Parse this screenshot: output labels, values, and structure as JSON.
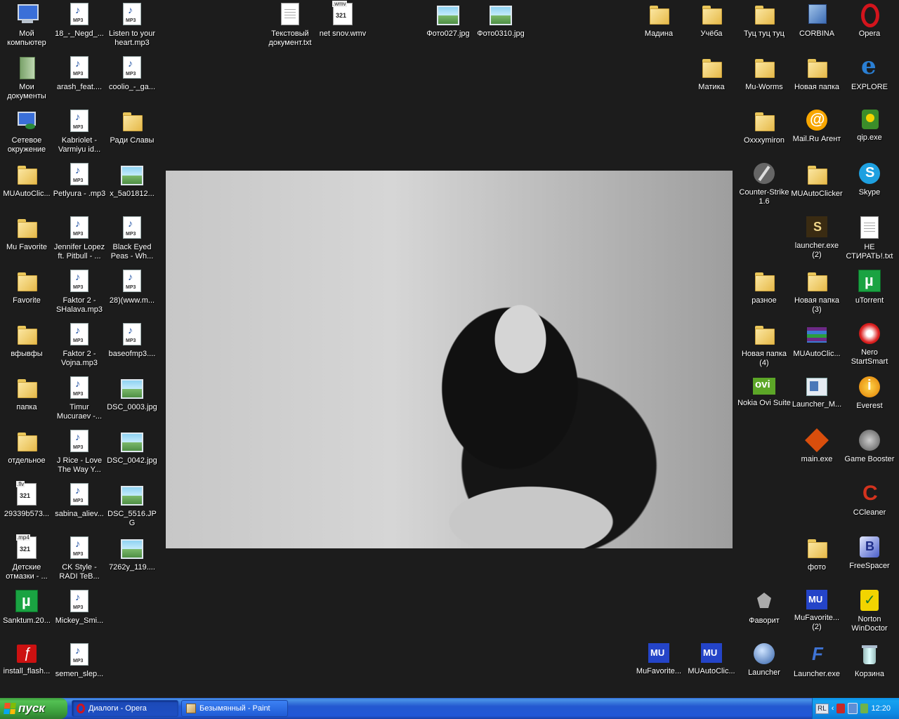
{
  "desktop": {
    "icons": [
      {
        "label": "Мой компьютер",
        "glyph": "g-computer",
        "icon": "computer-icon"
      },
      {
        "label": "18_-_Negd_...",
        "glyph": "g-mp3",
        "icon": "mp3-file-icon"
      },
      {
        "label": "Listen to your heart.mp3",
        "glyph": "g-mp3",
        "icon": "mp3-file-icon"
      },
      {
        "label": "Текстовый документ.txt",
        "glyph": "g-txt",
        "icon": "text-file-icon"
      },
      {
        "label": "net snov.wmv",
        "glyph": "g-video",
        "icon": "video-file-icon",
        "ext": ".wmv"
      },
      {
        "label": "Фото027.jpg",
        "glyph": "g-image",
        "icon": "image-file-icon"
      },
      {
        "label": "Фото0310.jpg",
        "glyph": "g-image",
        "icon": "image-file-icon"
      },
      {
        "label": "Мадина",
        "glyph": "g-folder",
        "icon": "folder-icon"
      },
      {
        "label": "Учёба",
        "glyph": "g-folder",
        "icon": "folder-icon"
      },
      {
        "label": "Туц туц туц",
        "glyph": "g-folder",
        "icon": "folder-icon"
      },
      {
        "label": "CORBINA",
        "glyph": "g-corbina",
        "icon": "network-connection-icon"
      },
      {
        "label": "Opera",
        "glyph": "g-opera",
        "icon": "opera-icon"
      },
      {
        "label": "Мои документы",
        "glyph": "g-docs",
        "icon": "my-documents-icon"
      },
      {
        "label": "arash_feat....",
        "glyph": "g-mp3",
        "icon": "mp3-file-icon"
      },
      {
        "label": "coolio_-_ga...",
        "glyph": "g-mp3",
        "icon": "mp3-file-icon"
      },
      {
        "label": "Матика",
        "glyph": "g-folder",
        "icon": "folder-icon"
      },
      {
        "label": "Mu-Worms",
        "glyph": "g-folder",
        "icon": "folder-icon"
      },
      {
        "label": "Новая папка",
        "glyph": "g-folder",
        "icon": "folder-icon"
      },
      {
        "label": "EXPLORE",
        "glyph": "g-ie",
        "icon": "internet-explorer-icon"
      },
      {
        "label": "Сетевое окружение",
        "glyph": "g-network",
        "icon": "network-places-icon"
      },
      {
        "label": "Kabriolet - Varmiyu id...",
        "glyph": "g-mp3",
        "icon": "mp3-file-icon"
      },
      {
        "label": "Ради Славы",
        "glyph": "g-folder",
        "icon": "folder-icon"
      },
      {
        "label": "Oxxxymiron",
        "glyph": "g-folder",
        "icon": "folder-icon"
      },
      {
        "label": "Mail.Ru Агент",
        "glyph": "g-mailru",
        "icon": "mailru-agent-icon"
      },
      {
        "label": "qip.exe",
        "glyph": "g-qip",
        "icon": "qip-icon"
      },
      {
        "label": "MUAutoClic...",
        "glyph": "g-folder",
        "icon": "folder-icon"
      },
      {
        "label": "Petlyura - .mp3",
        "glyph": "g-mp3",
        "icon": "mp3-file-icon"
      },
      {
        "label": "x_5a01812...",
        "glyph": "g-image",
        "icon": "image-file-icon"
      },
      {
        "label": "Counter-Strike 1.6",
        "glyph": "g-cs",
        "icon": "counter-strike-icon"
      },
      {
        "label": "MUAutoClicker",
        "glyph": "g-folder",
        "icon": "folder-icon"
      },
      {
        "label": "Skype",
        "glyph": "g-skype",
        "icon": "skype-icon"
      },
      {
        "label": "Mu Favorite",
        "glyph": "g-folder",
        "icon": "folder-icon"
      },
      {
        "label": "Jennifer Lopez ft. Pitbull - ...",
        "glyph": "g-mp3",
        "icon": "mp3-file-icon"
      },
      {
        "label": "Black Eyed Peas - Wh...",
        "glyph": "g-mp3",
        "icon": "mp3-file-icon"
      },
      {
        "label": "launcher.exe (2)",
        "glyph": "g-launcher1",
        "icon": "launcher-exe-icon"
      },
      {
        "label": "НЕ СТИРАТЬ!.txt",
        "glyph": "g-txt",
        "icon": "text-file-icon"
      },
      {
        "label": "Favorite",
        "glyph": "g-folder",
        "icon": "folder-icon"
      },
      {
        "label": "Faktor 2 - SHalava.mp3",
        "glyph": "g-mp3",
        "icon": "mp3-file-icon"
      },
      {
        "label": "28)(www.m...",
        "glyph": "g-mp3",
        "icon": "mp3-file-icon"
      },
      {
        "label": "разное",
        "glyph": "g-folder",
        "icon": "folder-icon"
      },
      {
        "label": "Новая папка (3)",
        "glyph": "g-folder",
        "icon": "folder-icon"
      },
      {
        "label": "uTorrent",
        "glyph": "g-utorrent",
        "icon": "utorrent-icon"
      },
      {
        "label": "вфывфы",
        "glyph": "g-folder",
        "icon": "folder-icon"
      },
      {
        "label": "Faktor 2 - Vojna.mp3",
        "glyph": "g-mp3",
        "icon": "mp3-file-icon"
      },
      {
        "label": "baseofmp3....",
        "glyph": "g-mp3",
        "icon": "mp3-file-icon"
      },
      {
        "label": "Новая папка (4)",
        "glyph": "g-folder",
        "icon": "folder-icon"
      },
      {
        "label": "MUAutoClic...",
        "glyph": "g-winrar",
        "icon": "winrar-archive-icon"
      },
      {
        "label": "Nero StartSmart",
        "glyph": "g-nero",
        "icon": "nero-icon"
      },
      {
        "label": "папка",
        "glyph": "g-folder",
        "icon": "folder-icon"
      },
      {
        "label": "Timur Mucuraev -...",
        "glyph": "g-mp3",
        "icon": "mp3-file-icon"
      },
      {
        "label": "DSC_0003.jpg",
        "glyph": "g-image",
        "icon": "image-file-icon"
      },
      {
        "label": "Nokia Ovi Suite",
        "glyph": "g-ovi",
        "icon": "nokia-ovi-icon"
      },
      {
        "label": "Launcher_M...",
        "glyph": "g-launcherm",
        "icon": "launcher-shortcut-icon"
      },
      {
        "label": "Everest",
        "glyph": "g-everest",
        "icon": "everest-icon"
      },
      {
        "label": "отдельное",
        "glyph": "g-folder",
        "icon": "folder-icon"
      },
      {
        "label": "J Rice - Love The Way Y...",
        "glyph": "g-mp3",
        "icon": "mp3-file-icon"
      },
      {
        "label": "DSC_0042.jpg",
        "glyph": "g-image",
        "icon": "image-file-icon"
      },
      {
        "label": "main.exe",
        "glyph": "g-main",
        "icon": "main-exe-icon"
      },
      {
        "label": "Game Booster",
        "glyph": "g-booster",
        "icon": "game-booster-icon"
      },
      {
        "label": "29339b573...",
        "glyph": "g-video",
        "icon": "video-file-icon",
        "ext": ".flv"
      },
      {
        "label": "sabina_aliev...",
        "glyph": "g-mp3",
        "icon": "mp3-file-icon"
      },
      {
        "label": "DSC_5516.JPG",
        "glyph": "g-image",
        "icon": "image-file-icon"
      },
      {
        "label": "CCleaner",
        "glyph": "g-ccleaner",
        "icon": "ccleaner-icon"
      },
      {
        "label": "Детские отмазки - ...",
        "glyph": "g-video",
        "icon": "video-file-icon",
        "ext": ".mp4"
      },
      {
        "label": "CK Style - RADI TeB...",
        "glyph": "g-mp3",
        "icon": "mp3-file-icon"
      },
      {
        "label": "7262y_119....",
        "glyph": "g-image",
        "icon": "image-file-icon"
      },
      {
        "label": "фото",
        "glyph": "g-folder",
        "icon": "folder-icon"
      },
      {
        "label": "FreeSpacer",
        "glyph": "g-freespacer",
        "icon": "freespacer-icon"
      },
      {
        "label": "Sanktum.20...",
        "glyph": "g-utorrent",
        "icon": "torrent-file-icon"
      },
      {
        "label": "Mickey_Smi...",
        "glyph": "g-mp3",
        "icon": "mp3-file-icon"
      },
      {
        "label": "Фаворит",
        "glyph": "g-favorit",
        "icon": "favorit-icon"
      },
      {
        "label": "MuFavorite... (2)",
        "glyph": "g-mu",
        "icon": "mu-icon"
      },
      {
        "label": "Norton WinDoctor",
        "glyph": "g-norton",
        "icon": "norton-icon"
      },
      {
        "label": "install_flash...",
        "glyph": "g-flash",
        "icon": "flash-installer-icon"
      },
      {
        "label": "semen_slep...",
        "glyph": "g-mp3",
        "icon": "mp3-file-icon"
      },
      {
        "label": "MuFavorite...",
        "glyph": "g-mu",
        "icon": "mu-icon"
      },
      {
        "label": "MUAutoClic...",
        "glyph": "g-mu",
        "icon": "mu-icon"
      },
      {
        "label": "Launcher",
        "glyph": "g-launcher2",
        "icon": "launcher-icon"
      },
      {
        "label": "Launcher.exe",
        "glyph": "g-launcherexe",
        "icon": "launcher-exe-icon"
      },
      {
        "label": "Корзина",
        "glyph": "g-trash",
        "icon": "recycle-bin-icon"
      }
    ]
  },
  "taskbar": {
    "start_label": "пуск",
    "tasks": [
      {
        "label": "Диалоги - Opera",
        "icon": "opera-icon",
        "active": true
      },
      {
        "label": "Безымянный - Paint",
        "icon": "paint-icon",
        "active": false
      }
    ],
    "tray": {
      "language": "RL",
      "clock": "12:20"
    }
  },
  "colors": {
    "desktop_background": "#1c1c1c",
    "taskbar_blue": "#2358d0",
    "start_green": "#3a9c3a",
    "tray_blue": "#0e8be5"
  }
}
